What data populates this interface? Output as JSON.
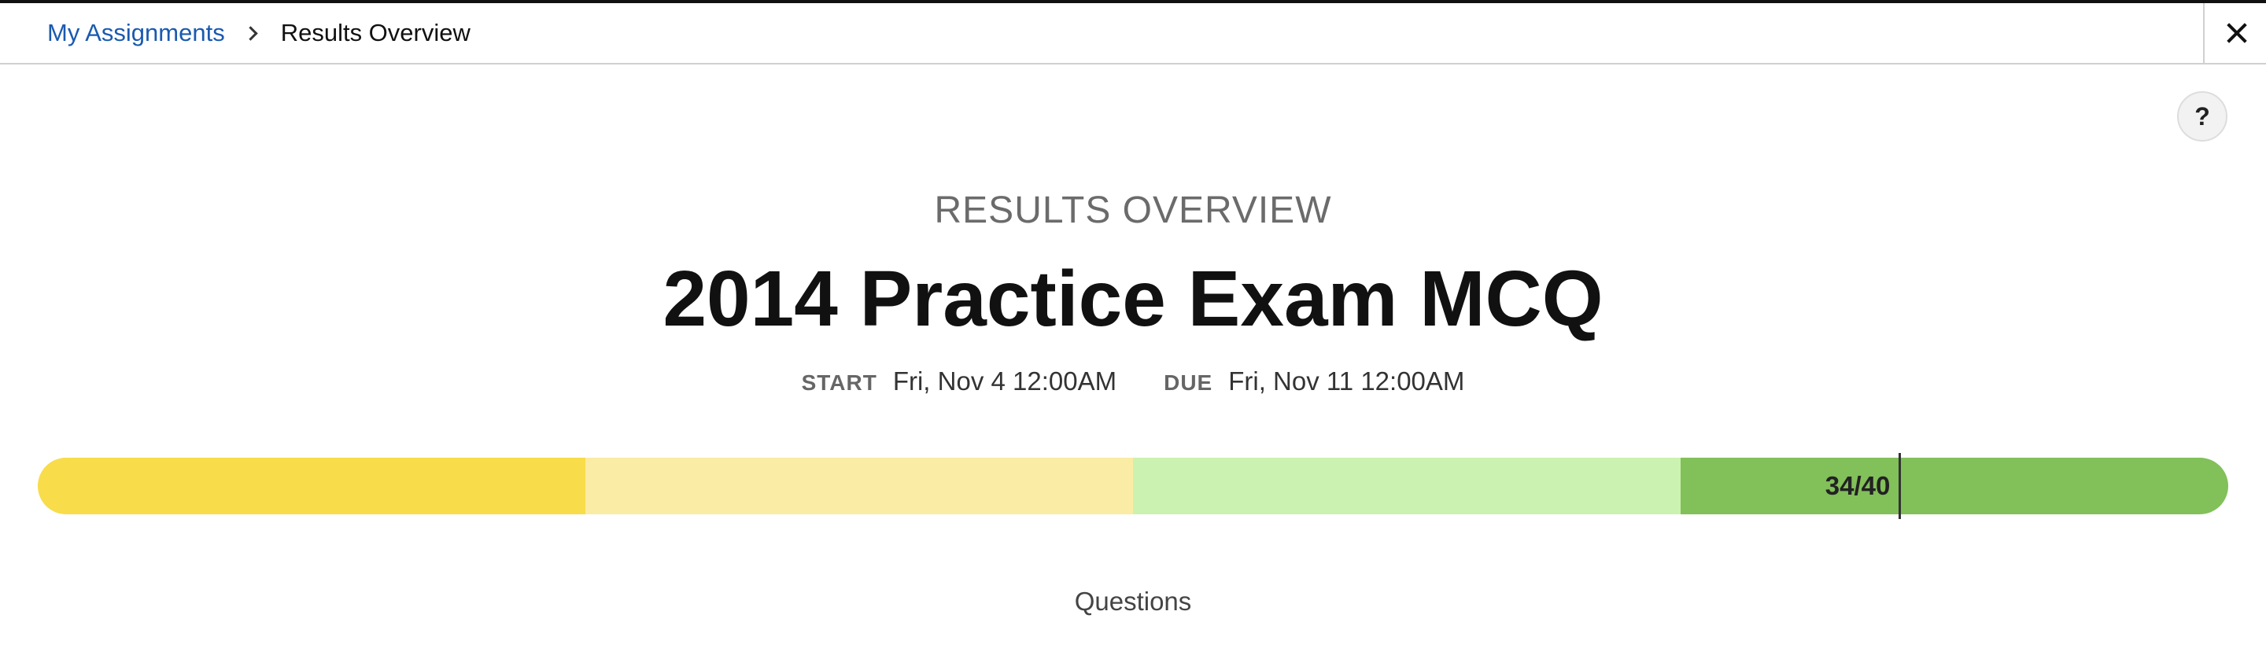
{
  "breadcrumb": {
    "parent": "My Assignments",
    "current": "Results Overview"
  },
  "icons": {
    "separator": "chevron-right-icon",
    "close": "close-icon",
    "help": "help-icon"
  },
  "help": {
    "label": "?"
  },
  "header": {
    "overline": "RESULTS OVERVIEW",
    "title": "2014 Practice Exam MCQ"
  },
  "dates": {
    "start_label": "START",
    "start_value": "Fri, Nov 4 12:00AM",
    "due_label": "DUE",
    "due_value": "Fri, Nov 11 12:00AM"
  },
  "score": {
    "label": "34/40",
    "earned": 34,
    "total": 40,
    "band_colors": [
      "#f8dc4a",
      "#fbeca5",
      "#cbf2b0",
      "#82c05a"
    ]
  },
  "section": {
    "questions_label": "Questions"
  },
  "colors": {
    "link": "#1a5ab0",
    "title": "#111111",
    "muted": "#6b6b6b"
  }
}
